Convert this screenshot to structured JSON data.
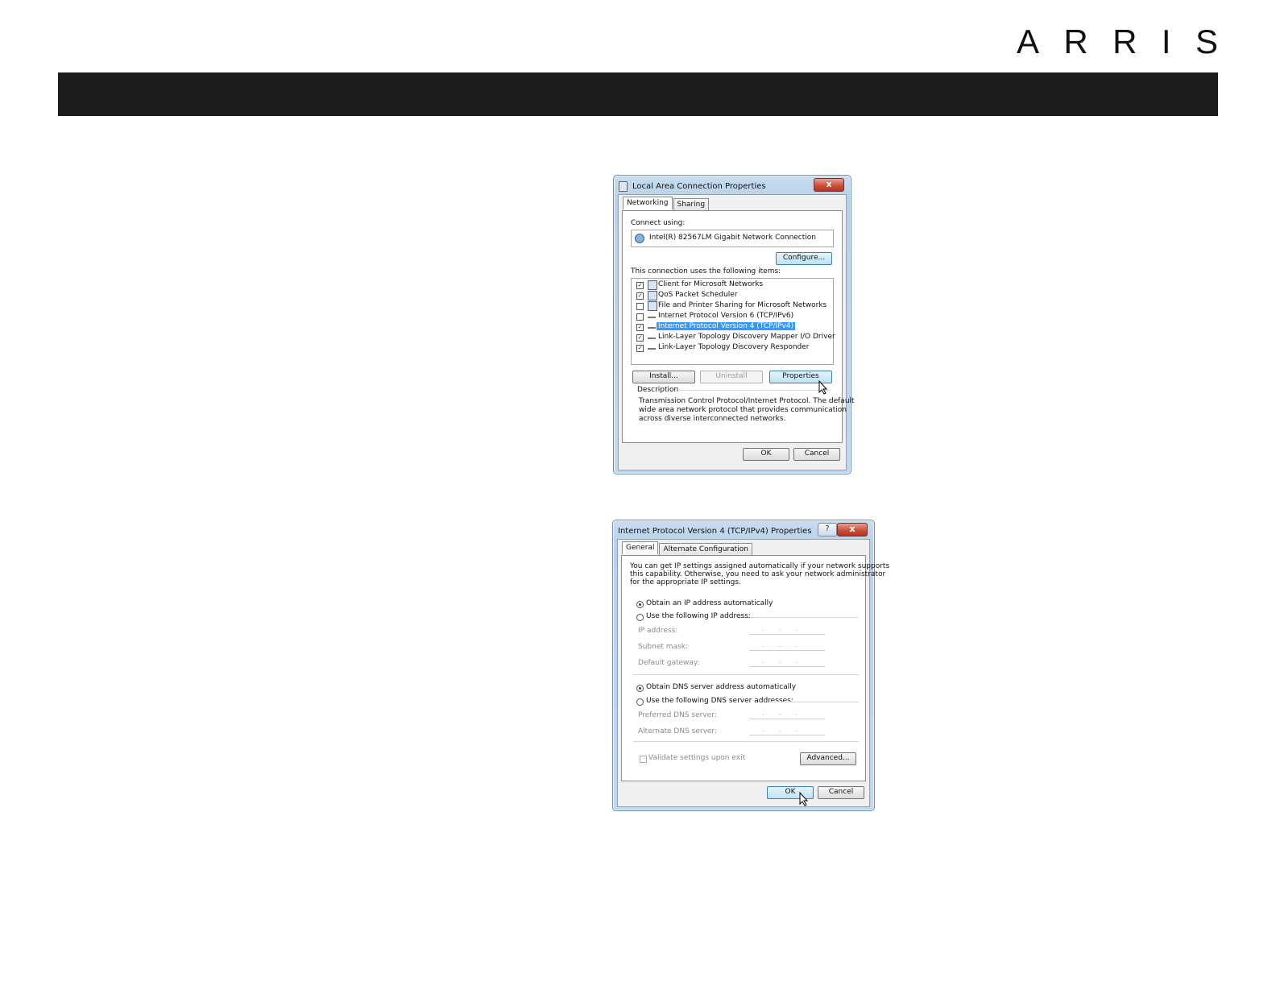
{
  "brand": {
    "logo_letters": [
      "A",
      "R",
      "R",
      "I",
      "S"
    ],
    "banner_color": "#1c1c1c"
  },
  "lan_dialog": {
    "title": "Local Area Connection Properties",
    "close_label": "x",
    "tabs": [
      "Networking",
      "Sharing"
    ],
    "connect_using_label": "Connect using:",
    "adapter_name": "Intel(R) 82567LM Gigabit Network Connection",
    "configure_label": "Configure...",
    "items_label": "This connection uses the following items:",
    "items": [
      {
        "label": "Client for Microsoft Networks",
        "checked": true,
        "icon": "network-client-icon"
      },
      {
        "label": "QoS Packet Scheduler",
        "checked": true,
        "icon": "network-service-icon"
      },
      {
        "label": "File and Printer Sharing for Microsoft Networks",
        "checked": false,
        "icon": "network-service-icon"
      },
      {
        "label": "Internet Protocol Version 6 (TCP/IPv6)",
        "checked": false,
        "icon": "protocol-icon"
      },
      {
        "label": "Internet Protocol Version 4 (TCP/IPv4)",
        "checked": true,
        "icon": "protocol-icon",
        "selected": true
      },
      {
        "label": "Link-Layer Topology Discovery Mapper I/O Driver",
        "checked": true,
        "icon": "protocol-icon"
      },
      {
        "label": "Link-Layer Topology Discovery Responder",
        "checked": true,
        "icon": "protocol-icon"
      }
    ],
    "install_label": "Install...",
    "uninstall_label": "Uninstall",
    "properties_label": "Properties",
    "description_label": "Description",
    "description_lines": [
      "Transmission Control Protocol/Internet Protocol. The default",
      "wide area network protocol that provides communication",
      "across diverse interconnected networks."
    ],
    "ok_label": "OK",
    "cancel_label": "Cancel"
  },
  "ipv4_dialog": {
    "title": "Internet Protocol Version 4 (TCP/IPv4) Properties",
    "help_label": "?",
    "close_label": "x",
    "tabs": [
      "General",
      "Alternate Configuration"
    ],
    "intro_lines": [
      "You can get IP settings assigned automatically if your network supports",
      "this capability. Otherwise, you need to ask your network administrator",
      "for the appropriate IP settings."
    ],
    "obtain_ip_auto": "Obtain an IP address automatically",
    "use_following_ip": "Use the following IP address:",
    "ip_address_label": "IP address:",
    "subnet_mask_label": "Subnet mask:",
    "default_gateway_label": "Default gateway:",
    "obtain_dns_auto": "Obtain DNS server address automatically",
    "use_following_dns": "Use the following DNS server addresses:",
    "preferred_dns_label": "Preferred DNS server:",
    "alternate_dns_label": "Alternate DNS server:",
    "ip_placeholder": "...",
    "validate_label": "Validate settings upon exit",
    "advanced_label": "Advanced...",
    "ok_label": "OK",
    "cancel_label": "Cancel"
  }
}
